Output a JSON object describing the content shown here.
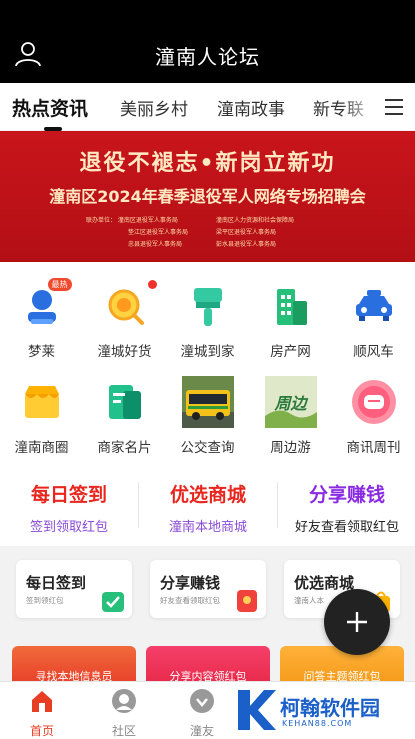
{
  "header": {
    "title": "潼南人论坛"
  },
  "tabs": [
    {
      "label": "热点资讯"
    },
    {
      "label": "美丽乡村"
    },
    {
      "label": "潼南政事"
    },
    {
      "label": "新专联"
    }
  ],
  "banner": {
    "headline": "退役不褪志•新岗立新功",
    "subheadline": "潼南区2024年春季退役军人网络专场招聘会",
    "units": [
      [
        "联办单位：  潼南区退役军人事务局",
        "潼南区人力资源和社会保障局"
      ],
      [
        "垫江区退役军人事务局",
        "梁平区退役军人事务局"
      ],
      [
        "忠县退役军人事务局",
        "彭水县退役军人事务局"
      ]
    ]
  },
  "grid": [
    {
      "label": "梦莱",
      "icon": "person-icon",
      "badge": "最热"
    },
    {
      "label": "潼城好货",
      "icon": "magnifier-icon",
      "dot": true
    },
    {
      "label": "潼城到家",
      "icon": "brush-icon"
    },
    {
      "label": "房产网",
      "icon": "building-icon"
    },
    {
      "label": "顺风车",
      "icon": "car-icon"
    },
    {
      "label": "潼南商圈",
      "icon": "shop-icon"
    },
    {
      "label": "商家名片",
      "icon": "card-icon"
    },
    {
      "label": "公交查询",
      "icon": "bus-photo-icon"
    },
    {
      "label": "周边游",
      "icon": "travel-photo-icon",
      "photo_text": "周边"
    },
    {
      "label": "商讯周刊",
      "icon": "chat-bubble-icon"
    }
  ],
  "promo": [
    {
      "title": "每日签到",
      "subtitle": "签到领取红包",
      "title_color": "#e8261e",
      "sub_color": "#8a4bd6"
    },
    {
      "title": "优选商城",
      "subtitle": "潼南本地商城",
      "title_color": "#e8261e",
      "sub_color": "#8a4bd6"
    },
    {
      "title": "分享赚钱",
      "subtitle": "好友查看领取红包",
      "title_color": "#8a2be2",
      "sub_color": "#222222"
    }
  ],
  "cards": [
    {
      "title": "每日签到",
      "subtitle": "签到领红包"
    },
    {
      "title": "分享赚钱",
      "subtitle": "好友查看领取红包"
    },
    {
      "title": "优选商城",
      "subtitle": "潼南人本"
    }
  ],
  "banners2": [
    {
      "text": "寻找本地信息员"
    },
    {
      "text": "分享内容领红包"
    },
    {
      "text": "问答主题领红包"
    }
  ],
  "bottom_nav": [
    {
      "label": "首页",
      "active": true
    },
    {
      "label": "社区"
    },
    {
      "label": "潼友"
    }
  ],
  "watermark": {
    "text": "柯翰软件园",
    "url": "KEHAN88.COM"
  },
  "colors": {
    "accent": "#e73f24",
    "banner_red": "#c8151b",
    "topbar": "#000000"
  }
}
